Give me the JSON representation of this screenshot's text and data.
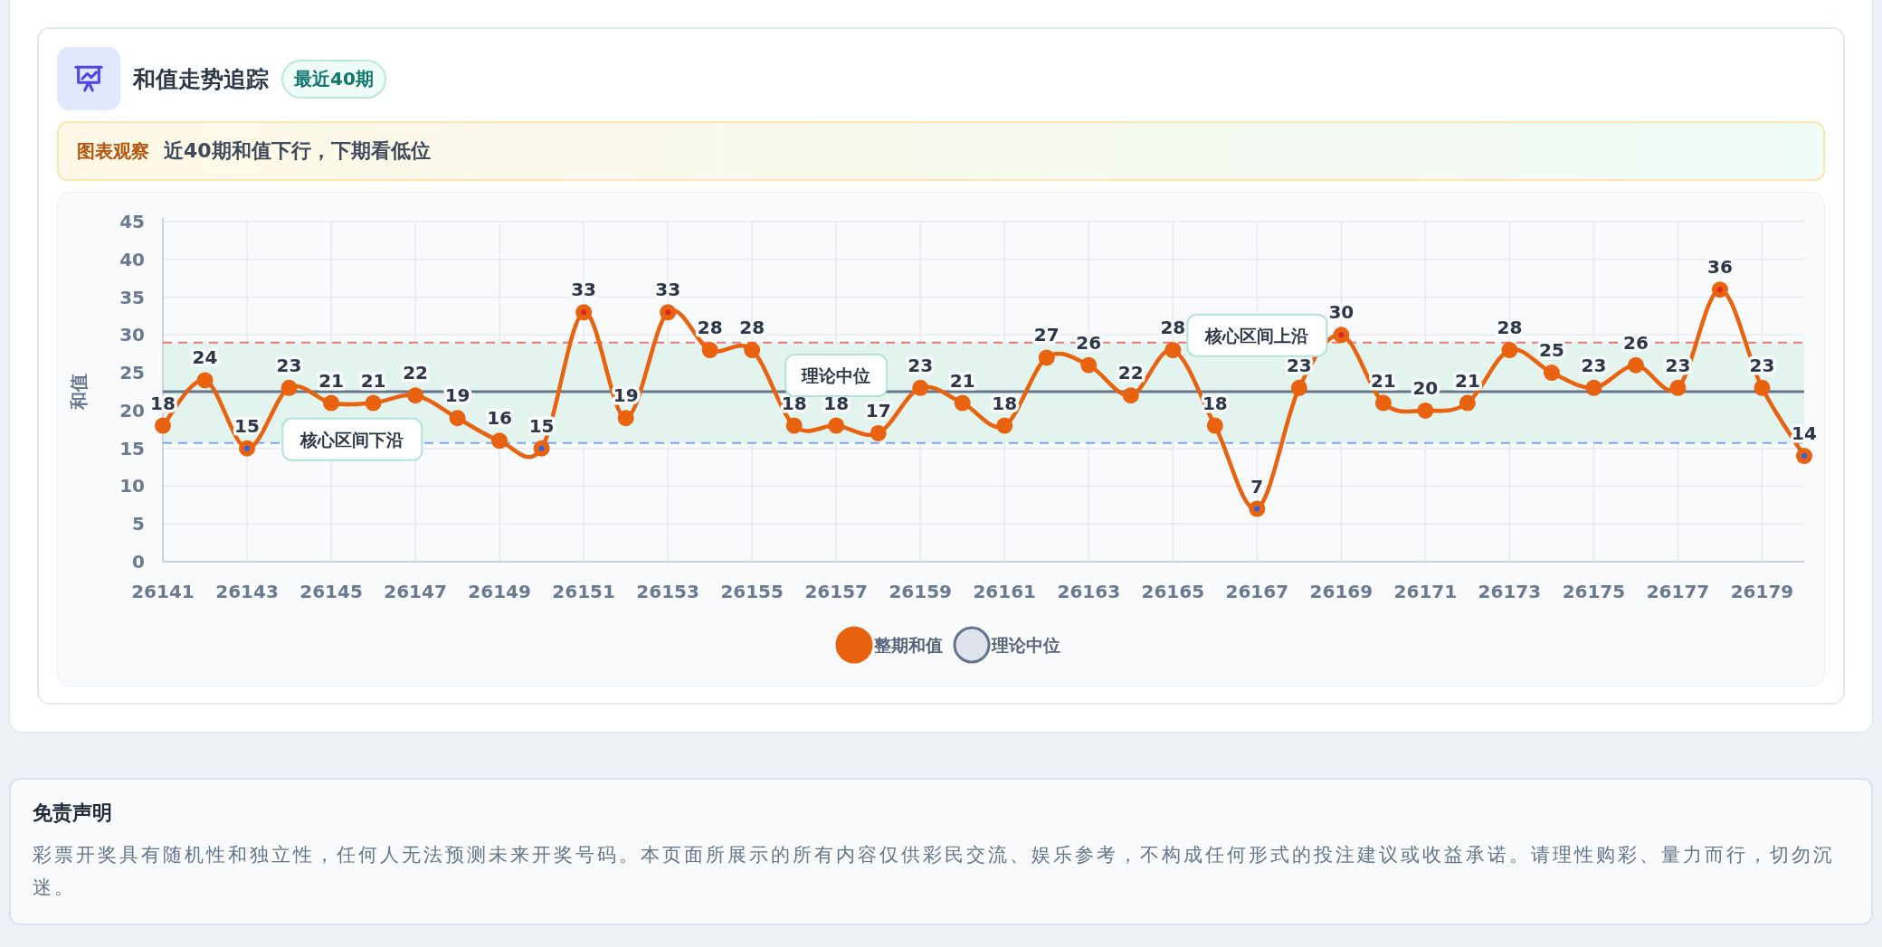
{
  "header": {
    "title": "和值走势追踪",
    "badge": "最近40期"
  },
  "insight": {
    "label": "图表观察",
    "text": "近40期和值下行，下期看低位"
  },
  "chart": {
    "chart_data": {
      "type": "line",
      "ylabel": "和值",
      "ylim": [
        0,
        45
      ],
      "yticks": [
        0,
        5,
        10,
        15,
        20,
        25,
        30,
        35,
        40,
        45
      ],
      "data_labels": true,
      "grid": true,
      "x": [
        26141,
        26142,
        26143,
        26144,
        26145,
        26146,
        26147,
        26148,
        26149,
        26150,
        26151,
        26152,
        26153,
        26154,
        26155,
        26156,
        26157,
        26158,
        26159,
        26160,
        26161,
        26162,
        26163,
        26164,
        26165,
        26166,
        26167,
        26168,
        26169,
        26170,
        26171,
        26172,
        26173,
        26174,
        26175,
        26176,
        26177,
        26178,
        26179,
        26180
      ],
      "xlim": [
        26141,
        26180
      ],
      "xticks": [
        26141,
        26143,
        26145,
        26147,
        26149,
        26151,
        26153,
        26155,
        26157,
        26159,
        26161,
        26163,
        26165,
        26167,
        26169,
        26171,
        26173,
        26175,
        26177,
        26179
      ],
      "series": [
        {
          "name": "整期和值",
          "color": "#e8620f",
          "marker": "circle",
          "values": [
            18,
            24,
            15,
            23,
            21,
            21,
            22,
            19,
            16,
            15,
            33,
            19,
            33,
            28,
            28,
            18,
            18,
            17,
            23,
            21,
            18,
            27,
            26,
            22,
            28,
            18,
            7,
            23,
            30,
            21,
            20,
            21,
            28,
            25,
            23,
            26,
            23,
            36,
            23,
            14
          ]
        }
      ],
      "ref_lines": [
        {
          "axis": "y",
          "value": 15.7,
          "label": "核心区间下沿",
          "color": "#7ea6f5",
          "line_style": "dashed"
        },
        {
          "axis": "y",
          "value": 22.5,
          "label": "理论中位",
          "color": "#64748b",
          "line_style": "solid"
        },
        {
          "axis": "y",
          "value": 29,
          "label": "核心区间上沿",
          "color": "#e87a7a",
          "line_style": "dashed"
        }
      ],
      "bands": [
        {
          "axis": "y",
          "from": 15.7,
          "to": 29,
          "color": "#e3f4ef"
        }
      ],
      "legend": true
    }
  },
  "disclaimer": {
    "title": "免责声明",
    "text": "彩票开奖具有随机性和独立性，任何人无法预测未来开奖号码。本页面所展示的所有内容仅供彩民交流、娱乐参考，不构成任何形式的投注建议或收益承诺。请理性购彩、量力而行，切勿沉迷。"
  }
}
